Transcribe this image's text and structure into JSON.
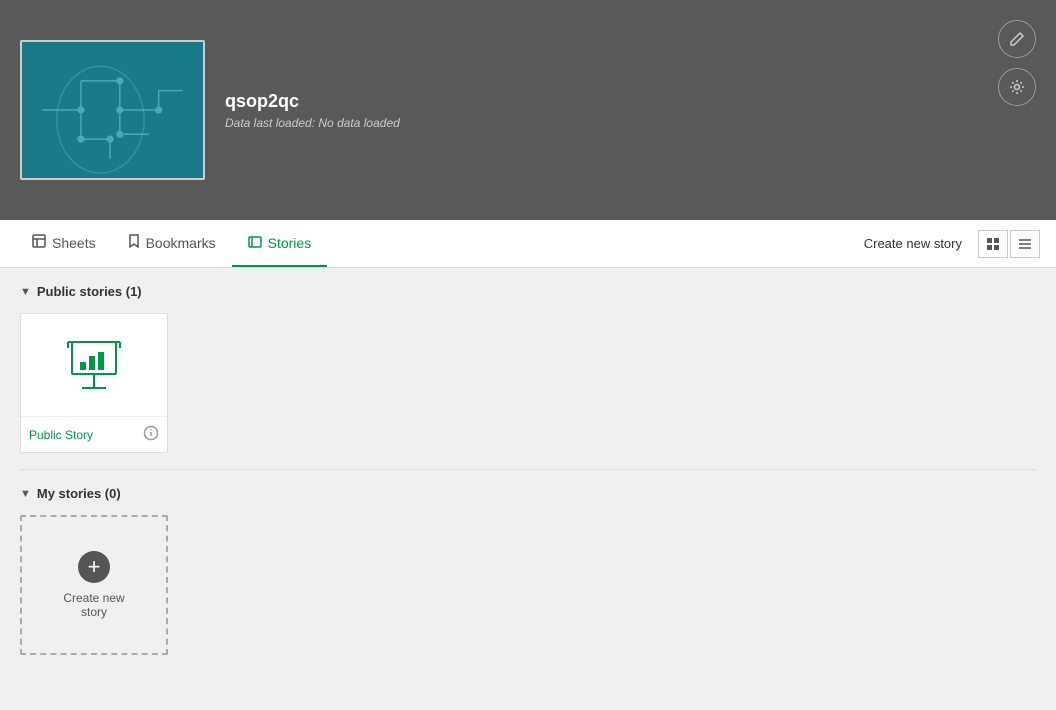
{
  "header": {
    "title": "qsop2qc",
    "subtitle": "Data last loaded: No data loaded",
    "edit_icon": "✎",
    "settings_icon": "⚙"
  },
  "nav": {
    "tabs": [
      {
        "id": "sheets",
        "label": "Sheets",
        "icon": "☐",
        "active": false
      },
      {
        "id": "bookmarks",
        "label": "Bookmarks",
        "icon": "🔖",
        "active": false
      },
      {
        "id": "stories",
        "label": "Stories",
        "icon": "▷",
        "active": true
      }
    ],
    "create_button_label": "Create new story",
    "grid_view_icon": "▦",
    "list_view_icon": "≡"
  },
  "public_stories": {
    "label": "Public stories (1)",
    "count": 1,
    "items": [
      {
        "id": "public-story",
        "title": "Public Story"
      }
    ]
  },
  "my_stories": {
    "label": "My stories (0)",
    "count": 0,
    "create_label": "Create new\nstory"
  }
}
